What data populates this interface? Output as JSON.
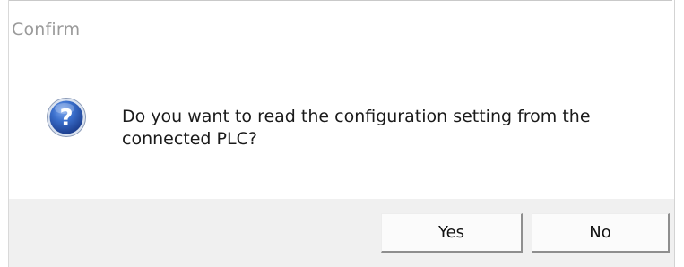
{
  "dialog": {
    "title": "Confirm",
    "icon": "question-icon",
    "message": "Do you want to read the configuration setting from the connected PLC?",
    "buttons": {
      "yes_label": "Yes",
      "no_label": "No"
    },
    "colors": {
      "icon_blue": "#2a5db8",
      "footer_bg": "#f0f0f0",
      "title_gray": "#9a9a9a"
    }
  }
}
